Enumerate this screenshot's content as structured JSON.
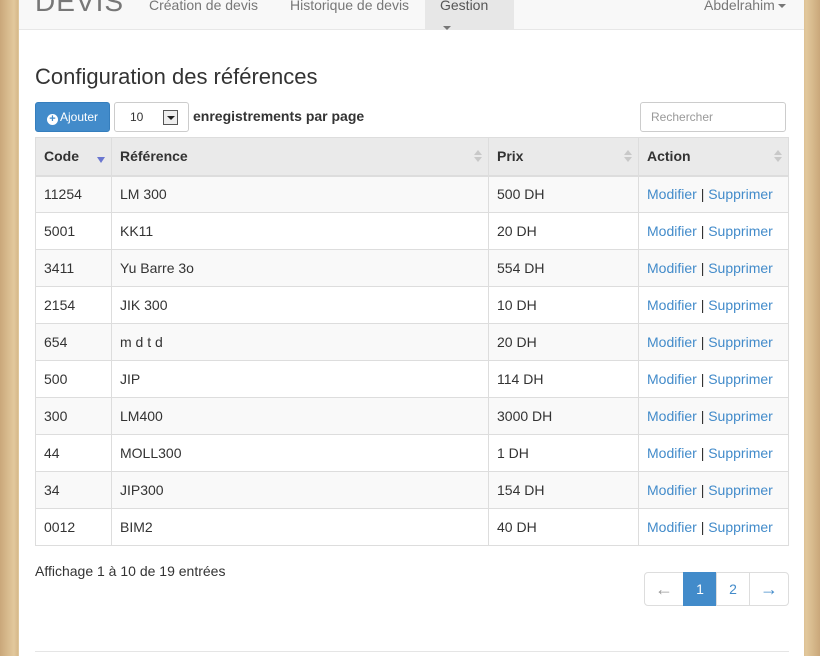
{
  "navbar": {
    "brand": "DEVIS",
    "items": [
      {
        "label": "Création de devis"
      },
      {
        "label": "Historique de devis"
      },
      {
        "label": "Gestion"
      }
    ],
    "user": "Abdelrahim"
  },
  "page": {
    "title": "Configuration des références"
  },
  "toolbar": {
    "add_label": "Ajouter",
    "page_size": "10",
    "per_page_label": "enregistrements par page",
    "search_placeholder": "Rechercher"
  },
  "table": {
    "headers": {
      "code": "Code",
      "reference": "Référence",
      "prix": "Prix",
      "action": "Action"
    },
    "edit_label": "Modifier",
    "delete_label": "Supprimer",
    "separator": "|",
    "rows": [
      {
        "code": "11254",
        "reference": "LM 300",
        "prix": "500 DH"
      },
      {
        "code": "5001",
        "reference": "KK11",
        "prix": "20 DH"
      },
      {
        "code": "3411",
        "reference": "Yu Barre 3o",
        "prix": "554 DH"
      },
      {
        "code": "2154",
        "reference": "JIK 300",
        "prix": "10 DH"
      },
      {
        "code": "654",
        "reference": "m d t d",
        "prix": "20 DH"
      },
      {
        "code": "500",
        "reference": "JIP",
        "prix": "114 DH"
      },
      {
        "code": "300",
        "reference": "LM400",
        "prix": "3000 DH"
      },
      {
        "code": "44",
        "reference": "MOLL300",
        "prix": "1 DH"
      },
      {
        "code": "34",
        "reference": "JIP300",
        "prix": "154 DH"
      },
      {
        "code": "0012",
        "reference": "BIM2",
        "prix": "40 DH"
      }
    ]
  },
  "footer": {
    "info": "Affichage 1 à 10 de 19 entrées"
  },
  "pagination": {
    "prev": "←",
    "pages": [
      "1",
      "2"
    ],
    "current": "1",
    "next": "→"
  },
  "colors": {
    "primary": "#428bca",
    "sort_active": "#6a76d0"
  }
}
